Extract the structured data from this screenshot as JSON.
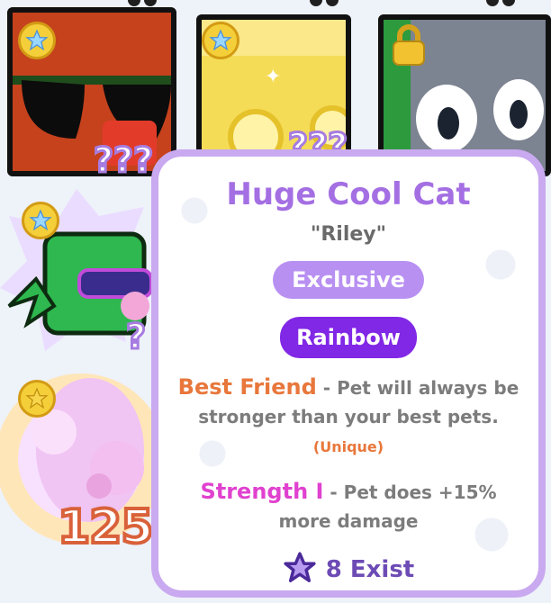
{
  "tooltip": {
    "pet_name": "Huge Cool Cat",
    "nickname": "\"Riley\"",
    "tags": [
      "Exclusive",
      "Rainbow"
    ],
    "enchants": [
      {
        "name": "Best Friend",
        "dash": " - ",
        "description": "Pet will always be stronger than your best pets.",
        "suffix": "(Unique)"
      },
      {
        "name": "Strength I",
        "dash": " - ",
        "description": "Pet does +15% more damage"
      }
    ],
    "exist_count": "8 Exist"
  },
  "inventory": {
    "unknown_marker": "???",
    "side_marker": "?",
    "pet_count": "125"
  },
  "colors": {
    "title": "#a46fe3",
    "exclusive_pill": "#b890f2",
    "rainbow_pill": "#8127e6",
    "best_friend": "#e8773b",
    "strength": "#e041cf",
    "border": "#c9a9ef"
  },
  "icons": [
    "star-badge-icon",
    "lock-icon",
    "star-outline-icon"
  ]
}
